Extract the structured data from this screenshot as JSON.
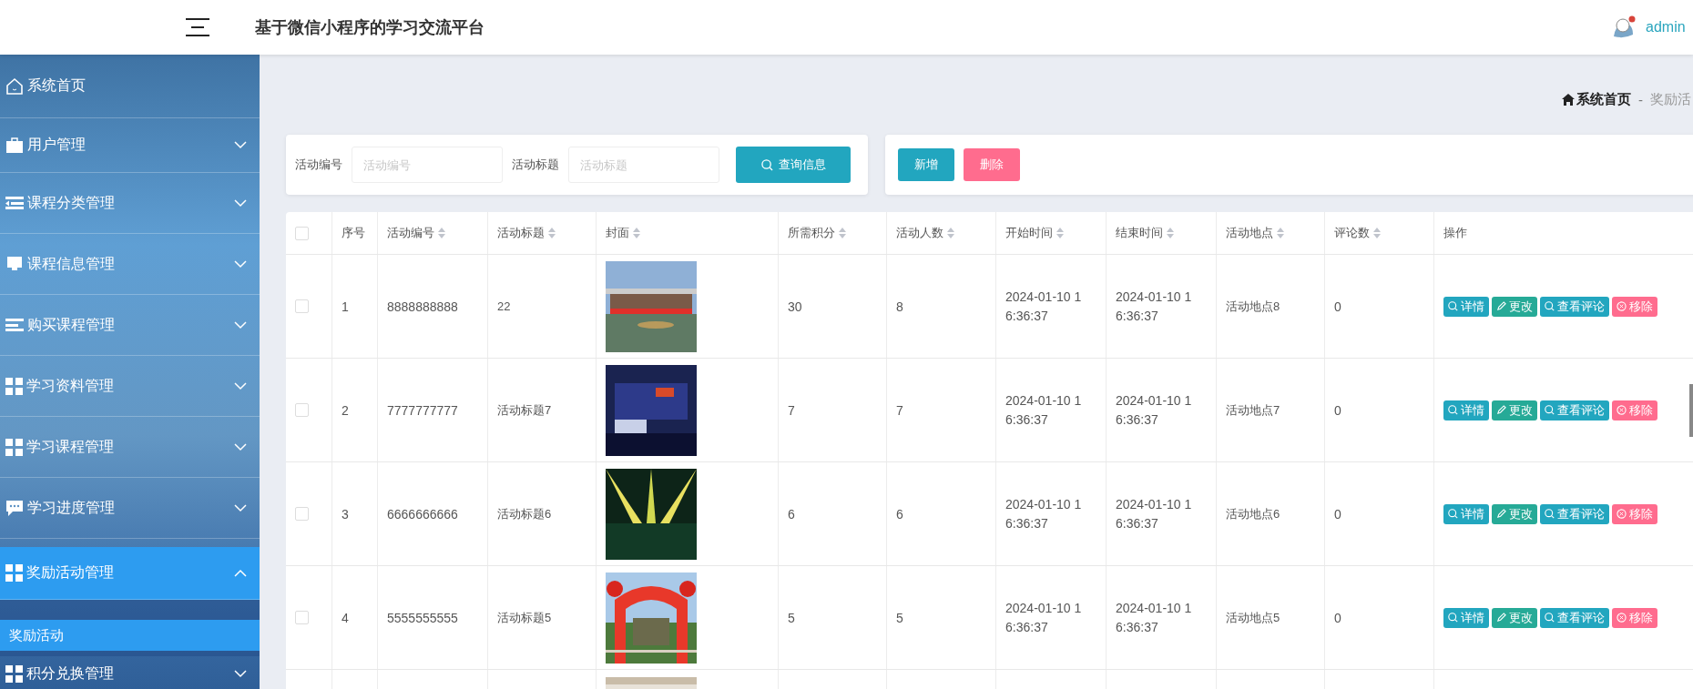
{
  "header": {
    "title": "基于微信小程序的学习交流平台",
    "user": "admin"
  },
  "sidebar": {
    "items": [
      {
        "label": "系统首页",
        "kind": "link",
        "selected": false
      },
      {
        "label": "用户管理",
        "kind": "menu",
        "expanded": false,
        "selected": false
      },
      {
        "label": "课程分类管理",
        "kind": "menu",
        "expanded": false,
        "selected": false
      },
      {
        "label": "课程信息管理",
        "kind": "menu",
        "expanded": false,
        "selected": false
      },
      {
        "label": "购买课程管理",
        "kind": "menu",
        "expanded": false,
        "selected": false
      },
      {
        "label": "学习资料管理",
        "kind": "menu",
        "expanded": false,
        "selected": false
      },
      {
        "label": "学习课程管理",
        "kind": "menu",
        "expanded": false,
        "selected": false
      },
      {
        "label": "学习进度管理",
        "kind": "menu",
        "expanded": false,
        "selected": false
      },
      {
        "label": "奖励活动管理",
        "kind": "menu",
        "expanded": true,
        "selected": true,
        "children": [
          {
            "label": "奖励活动",
            "selected": true
          }
        ]
      },
      {
        "label": "积分兑换管理",
        "kind": "menu",
        "expanded": false,
        "selected": false
      }
    ]
  },
  "breadcrumb": {
    "items": [
      "系统首页",
      "奖励活"
    ],
    "separator": "-"
  },
  "search": {
    "fields": [
      {
        "label": "活动编号",
        "placeholder": "活动编号"
      },
      {
        "label": "活动标题",
        "placeholder": "活动标题"
      }
    ],
    "button": "查询信息"
  },
  "actions": [
    {
      "label": "新增",
      "kind": "primary"
    },
    {
      "label": "删除",
      "kind": "danger"
    }
  ],
  "table": {
    "columns": [
      {
        "kind": "checkbox",
        "checked": false
      },
      {
        "label": "序号",
        "sortable": false
      },
      {
        "label": "活动编号",
        "sortable": true
      },
      {
        "label": "活动标题",
        "sortable": true
      },
      {
        "label": "封面",
        "sortable": true
      },
      {
        "label": "所需积分",
        "sortable": true
      },
      {
        "label": "活动人数",
        "sortable": true
      },
      {
        "label": "开始时间",
        "sortable": true
      },
      {
        "label": "结束时间",
        "sortable": true
      },
      {
        "label": "活动地点",
        "sortable": true
      },
      {
        "label": "评论数",
        "sortable": true
      },
      {
        "label": "操作",
        "sortable": false
      }
    ],
    "rows": [
      {
        "checked": false,
        "index": "1",
        "code": "8888888888",
        "title": "22",
        "cover": {
          "kind": "picture"
        },
        "points": "30",
        "people": "8",
        "start": "2024-01-10 16:36:37",
        "end": "2024-01-10 16:36:37",
        "place": "活动地点8",
        "comments": "0",
        "actions": [
          {
            "label": "详情",
            "kind": "view"
          },
          {
            "label": "更改",
            "kind": "edit"
          },
          {
            "label": "查看评论",
            "kind": "view"
          },
          {
            "label": "移除",
            "kind": "remove"
          }
        ]
      },
      {
        "checked": false,
        "index": "2",
        "code": "7777777777",
        "title": "活动标题7",
        "cover": {
          "kind": "picture"
        },
        "points": "7",
        "people": "7",
        "start": "2024-01-10 16:36:37",
        "end": "2024-01-10 16:36:37",
        "place": "活动地点7",
        "comments": "0",
        "actions": [
          {
            "label": "详情",
            "kind": "view"
          },
          {
            "label": "更改",
            "kind": "edit"
          },
          {
            "label": "查看评论",
            "kind": "view"
          },
          {
            "label": "移除",
            "kind": "remove"
          }
        ]
      },
      {
        "checked": false,
        "index": "3",
        "code": "6666666666",
        "title": "活动标题6",
        "cover": {
          "kind": "picture"
        },
        "points": "6",
        "people": "6",
        "start": "2024-01-10 16:36:37",
        "end": "2024-01-10 16:36:37",
        "place": "活动地点6",
        "comments": "0",
        "actions": [
          {
            "label": "详情",
            "kind": "view"
          },
          {
            "label": "更改",
            "kind": "edit"
          },
          {
            "label": "查看评论",
            "kind": "view"
          },
          {
            "label": "移除",
            "kind": "remove"
          }
        ]
      },
      {
        "checked": false,
        "index": "4",
        "code": "5555555555",
        "title": "活动标题5",
        "cover": {
          "kind": "picture"
        },
        "points": "5",
        "people": "5",
        "start": "2024-01-10 16:36:37",
        "end": "2024-01-10 16:36:37",
        "place": "活动地点5",
        "comments": "0",
        "actions": [
          {
            "label": "详情",
            "kind": "view"
          },
          {
            "label": "更改",
            "kind": "edit"
          },
          {
            "label": "查看评论",
            "kind": "view"
          },
          {
            "label": "移除",
            "kind": "remove"
          }
        ]
      },
      {
        "cover": {
          "kind": "picture"
        }
      }
    ]
  }
}
